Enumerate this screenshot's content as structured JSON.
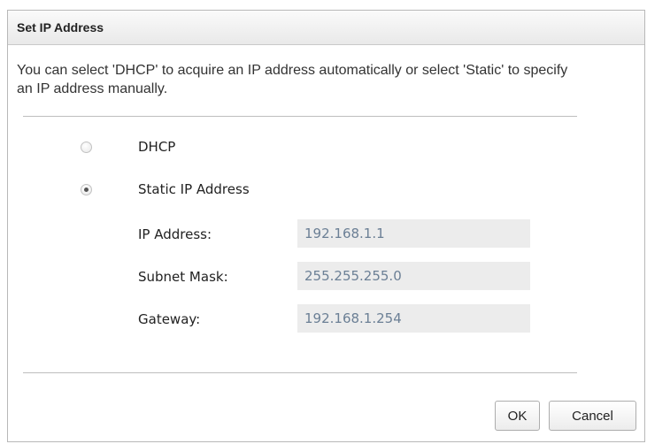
{
  "dialog": {
    "title": "Set IP Address",
    "description": "You can select 'DHCP' to acquire an IP address automatically or select 'Static' to specify an IP address manually.",
    "options": {
      "dhcp": {
        "label": "DHCP",
        "selected": false
      },
      "static": {
        "label": "Static IP Address",
        "selected": true
      }
    },
    "fields": {
      "ip": {
        "label": "IP Address:",
        "value": "192.168.1.1"
      },
      "subnet": {
        "label": "Subnet Mask:",
        "value": "255.255.255.0"
      },
      "gateway": {
        "label": "Gateway:",
        "value": "192.168.1.254"
      }
    },
    "buttons": {
      "ok": "OK",
      "cancel": "Cancel"
    }
  }
}
